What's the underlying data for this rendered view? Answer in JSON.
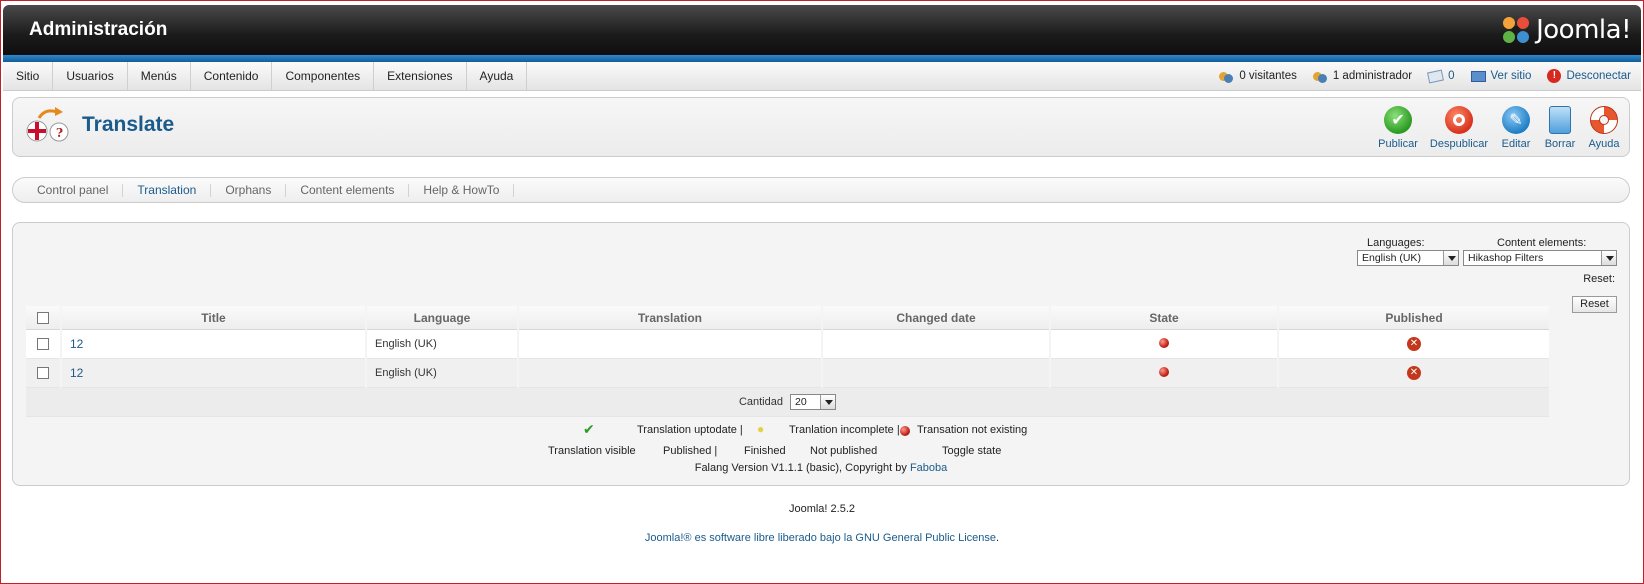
{
  "header": {
    "title": "Administración",
    "logo_text": "Joomla!"
  },
  "menu": {
    "items": [
      "Sitio",
      "Usuarios",
      "Menús",
      "Contenido",
      "Componentes",
      "Extensiones",
      "Ayuda"
    ]
  },
  "status": {
    "visitors": "0 visitantes",
    "admins": "1 administrador",
    "messages": "0",
    "view_site": "Ver sitio",
    "logout": "Desconectar"
  },
  "page": {
    "title": "Translate"
  },
  "toolbar": {
    "publish": "Publicar",
    "unpublish": "Despublicar",
    "edit": "Editar",
    "delete": "Borrar",
    "help": "Ayuda"
  },
  "submenu": {
    "items": [
      "Control panel",
      "Translation",
      "Orphans",
      "Content elements",
      "Help & HowTo"
    ],
    "active": "Translation"
  },
  "filters": {
    "languages_label": "Languages:",
    "languages_value": "English (UK)",
    "content_label": "Content elements:",
    "content_value": "Hikashop Filters",
    "reset_label": "Reset:",
    "reset_button": "Reset"
  },
  "table": {
    "columns": [
      "Title",
      "Language",
      "Translation",
      "Changed date",
      "State",
      "Published"
    ],
    "rows": [
      {
        "title": "12",
        "language": "English (UK)",
        "translation": "",
        "changed": "",
        "state": "not-existing",
        "published": "not-published"
      },
      {
        "title": "12",
        "language": "English (UK)",
        "translation": "",
        "changed": "",
        "state": "not-existing",
        "published": "not-published"
      }
    ],
    "pagination_label": "Cantidad",
    "pagination_value": "20"
  },
  "legend": {
    "uptodate": "Translation uptodate |",
    "incomplete": "Tranlation incomplete |",
    "not_existing": "Transation not existing",
    "visible": "Translation visible",
    "published": "Published |",
    "finished": "Finished",
    "not_published": "Not published",
    "toggle": "Toggle state",
    "version_text": "Falang Version V1.1.1 (basic), Copyright by",
    "version_link": "Faboba"
  },
  "footer": {
    "version": "Joomla! 2.5.2",
    "license_pre": "Joomla!® es software libre liberado bajo la",
    "license_link": "GNU General Public License",
    "license_post": "."
  },
  "colors": {
    "accent": "#1a5b8c",
    "header_dark": "#1b1b1b",
    "band_blue": "#2f88c9"
  }
}
